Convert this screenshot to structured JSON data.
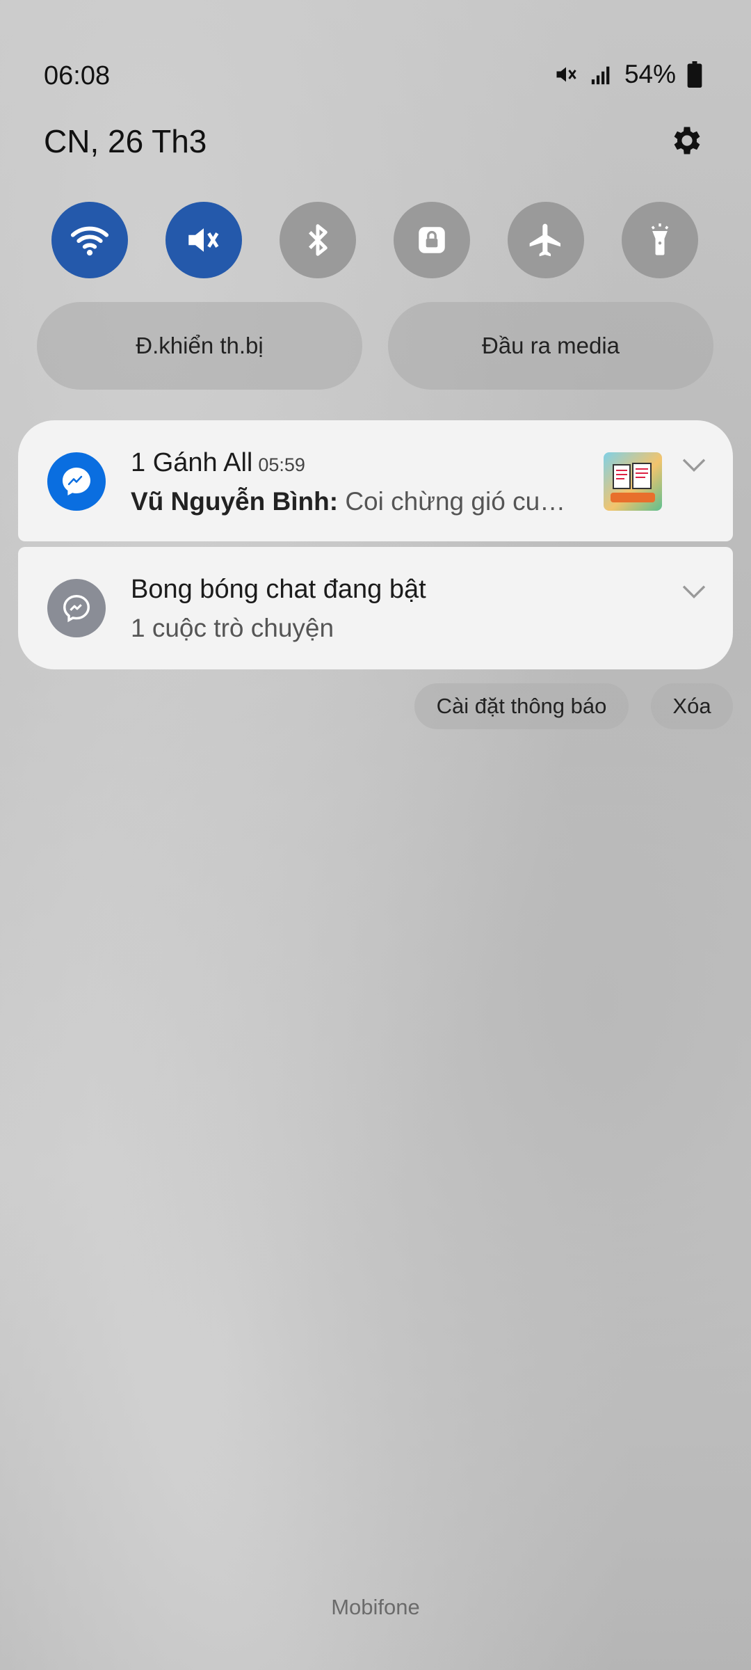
{
  "status_bar": {
    "time": "06:08",
    "battery": "54%",
    "icons": [
      "mute-vibrate-icon",
      "signal-icon",
      "battery-icon"
    ]
  },
  "panel": {
    "date": "CN, 26 Th3",
    "settings_icon": "gear-icon",
    "toggles": [
      {
        "name": "wifi",
        "icon": "wifi-icon",
        "active": true
      },
      {
        "name": "sound",
        "icon": "mute-icon",
        "active": true
      },
      {
        "name": "bluetooth",
        "icon": "bluetooth-icon",
        "active": false
      },
      {
        "name": "rotation-lock",
        "icon": "lock-icon",
        "active": false
      },
      {
        "name": "airplane-mode",
        "icon": "airplane-icon",
        "active": false
      },
      {
        "name": "flashlight",
        "icon": "flashlight-icon",
        "active": false
      }
    ],
    "device_control_label": "Đ.khiển th.bị",
    "media_output_label": "Đầu ra media"
  },
  "notifications": [
    {
      "app_icon": "messenger-icon",
      "title": "1 Gánh All",
      "time": "05:59",
      "sender": "Vũ Nguyễn Bình:",
      "message": "Coi chừng gió cu…",
      "has_thumbnail": true
    },
    {
      "app_icon": "messenger-icon",
      "title": "Bong bóng chat đang bật",
      "message": "1 cuộc trò chuyện"
    }
  ],
  "actions": {
    "settings_label": "Cài đặt thông báo",
    "clear_label": "Xóa"
  },
  "carrier": "Mobifone",
  "colors": {
    "toggle_active": "#2459ab",
    "toggle_inactive": "#9a9a9a",
    "messenger_blue": "#0a6ee0",
    "messenger_gray": "#8a8d96"
  }
}
